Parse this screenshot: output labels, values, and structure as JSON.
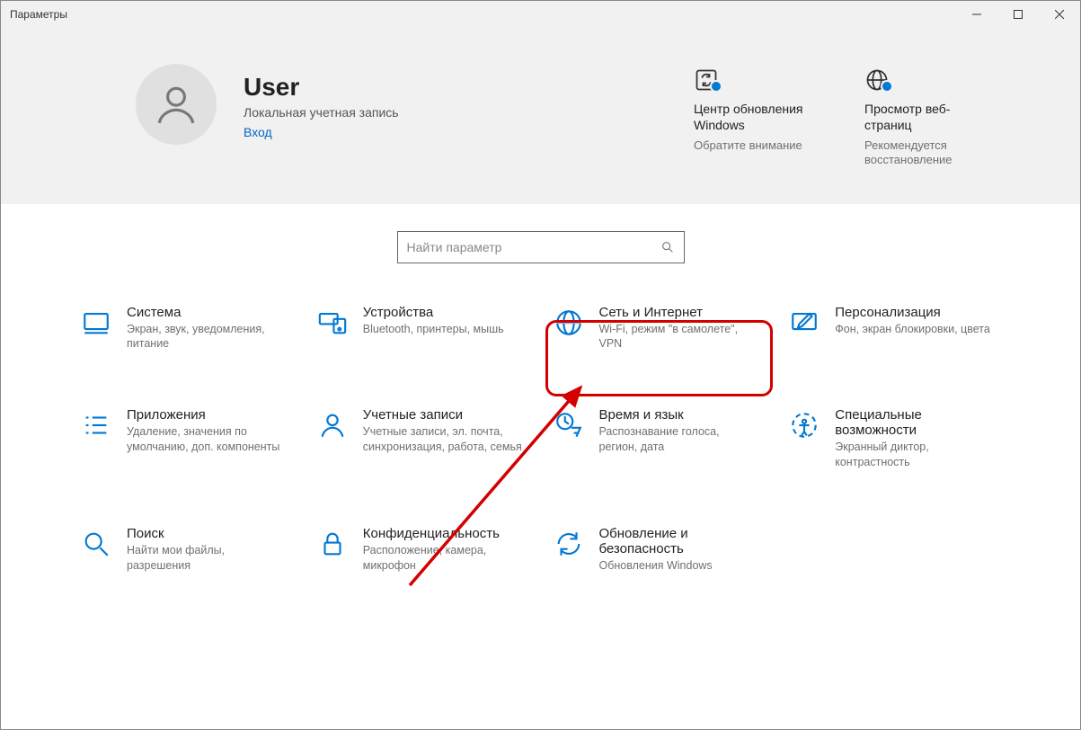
{
  "window": {
    "title": "Параметры"
  },
  "user": {
    "name": "User",
    "type": "Локальная учетная запись",
    "signin": "Вход"
  },
  "hero_tiles": [
    {
      "title": "Центр обновления Windows",
      "sub": "Обратите внимание"
    },
    {
      "title": "Просмотр веб-страниц",
      "sub": "Рекомендуется восстановление"
    }
  ],
  "search": {
    "placeholder": "Найти параметр"
  },
  "categories": [
    {
      "title": "Система",
      "sub": "Экран, звук, уведомления, питание"
    },
    {
      "title": "Устройства",
      "sub": "Bluetooth, принтеры, мышь"
    },
    {
      "title": "Сеть и Интернет",
      "sub": "Wi-Fi, режим \"в самолете\", VPN"
    },
    {
      "title": "Персонализация",
      "sub": "Фон, экран блокировки, цвета"
    },
    {
      "title": "Приложения",
      "sub": "Удаление, значения по умолчанию, доп. компоненты"
    },
    {
      "title": "Учетные записи",
      "sub": "Учетные записи, эл. почта, синхронизация, работа, семья"
    },
    {
      "title": "Время и язык",
      "sub": "Распознавание голоса, регион, дата"
    },
    {
      "title": "Специальные возможности",
      "sub": "Экранный диктор, контрастность"
    },
    {
      "title": "Поиск",
      "sub": "Найти мои файлы, разрешения"
    },
    {
      "title": "Конфиденциальность",
      "sub": "Расположение, камера, микрофон"
    },
    {
      "title": "Обновление и безопасность",
      "sub": "Обновления Windows"
    }
  ]
}
